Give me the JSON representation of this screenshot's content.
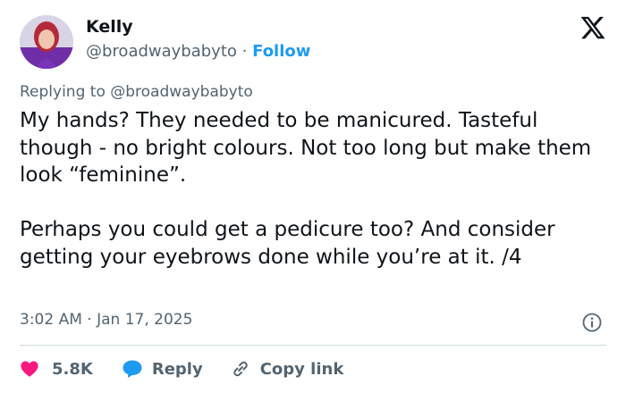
{
  "author": {
    "display_name": "Kelly",
    "handle": "@broadwaybabyto",
    "separator": "·",
    "follow_label": "Follow"
  },
  "platform_icon": "x-logo-icon",
  "reply_context": {
    "prefix": "Replying to",
    "handle": "@broadwaybabyto"
  },
  "tweet": {
    "paragraphs": [
      "My hands? They needed to be manicured. Tasteful though - no bright colours. Not too long but make them look “feminine”.",
      "Perhaps you could get a pedicure too? And consider getting your eyebrows done while you’re at it. /4"
    ],
    "timestamp": "3:02 AM · Jan 17, 2025"
  },
  "actions": {
    "likes_count": "5.8K",
    "reply_label": "Reply",
    "copy_link_label": "Copy link"
  },
  "colors": {
    "accent": "#1d9bf0",
    "like": "#f91880",
    "text": "#0f1419",
    "secondary_text": "#536471",
    "divider": "#cfd9de"
  },
  "icons": {
    "like": "heart-icon",
    "reply": "speech-bubble-icon",
    "copy": "link-icon",
    "info": "info-icon"
  }
}
